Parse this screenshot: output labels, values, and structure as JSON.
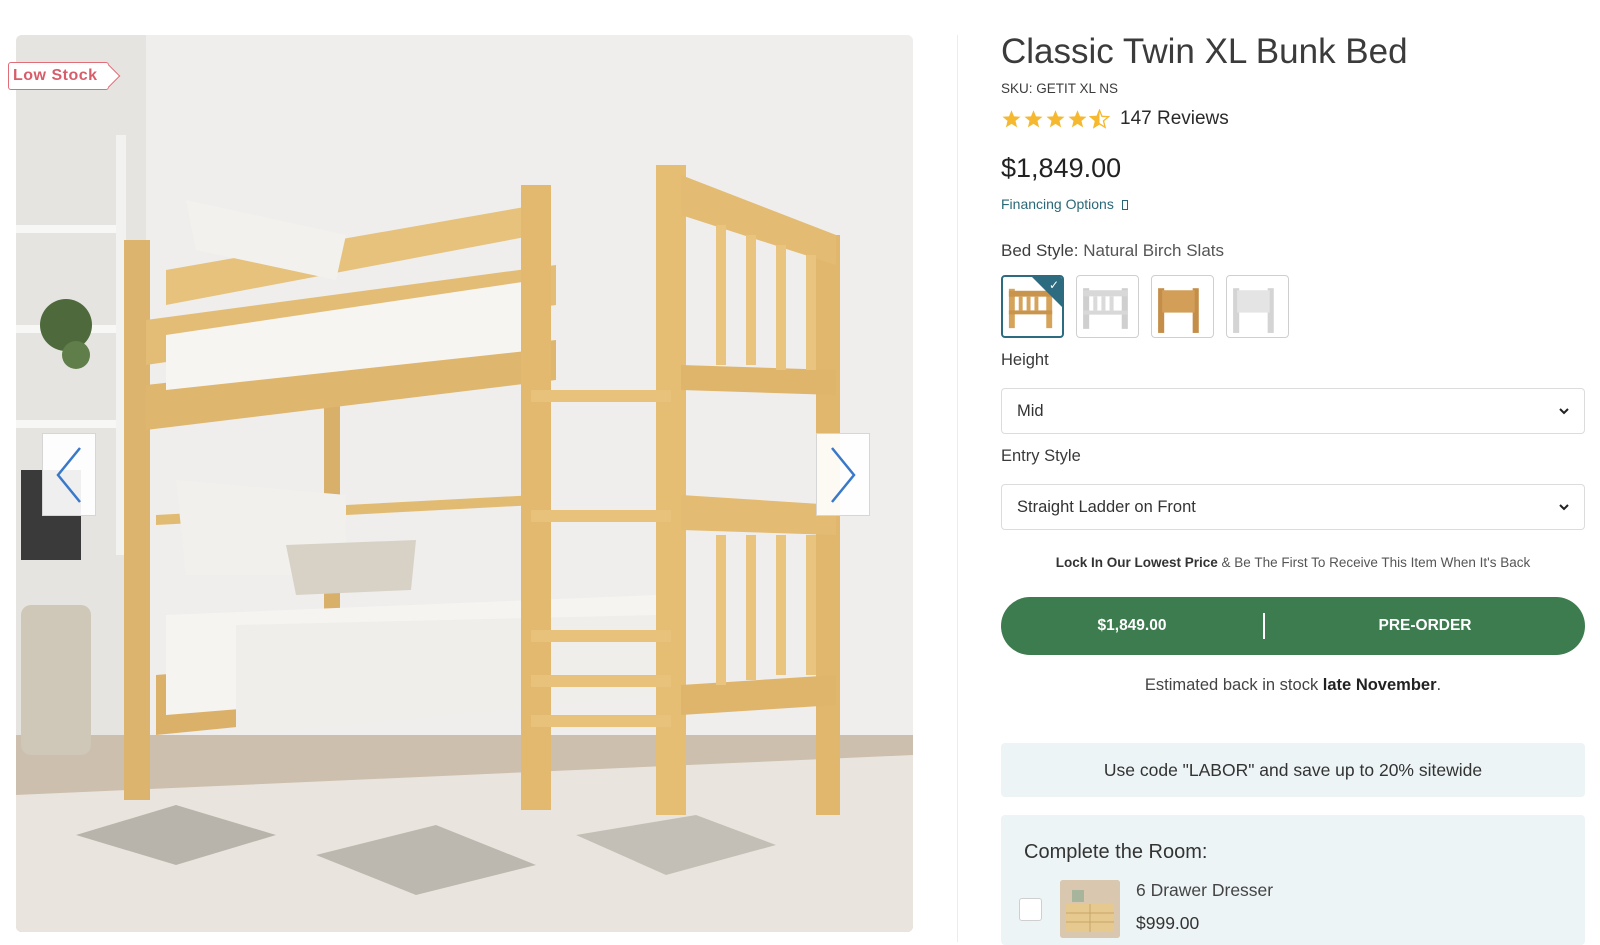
{
  "badge": {
    "low_stock": "Low Stock"
  },
  "product": {
    "title": "Classic Twin XL Bunk Bed",
    "sku": "SKU: GETIT XL NS",
    "rating": 4.5,
    "reviews_label": "147 Reviews",
    "price": "$1,849.00",
    "financing_label": "Financing Options"
  },
  "bed_style": {
    "label": "Bed Style:",
    "value": "Natural Birch Slats",
    "swatches": [
      "natural-slat-swatch",
      "white-slat-swatch",
      "natural-panel-swatch",
      "white-panel-swatch"
    ],
    "selected_index": 0
  },
  "height": {
    "label": "Height",
    "value": "Mid"
  },
  "entry_style": {
    "label": "Entry Style",
    "value": "Straight Ladder on Front"
  },
  "lock_in": {
    "bold": "Lock In Our Lowest Price",
    "rest": "& Be The First To Receive This Item When It's Back"
  },
  "cta": {
    "price": "$1,849.00",
    "action": "PRE-ORDER"
  },
  "estimate": {
    "prefix": "Estimated back in stock",
    "bold": "late November",
    "suffix": "."
  },
  "promo": "Use code \"LABOR\" and save up to 20% sitewide",
  "complete_room": {
    "title": "Complete the Room:",
    "item_name": "6 Drawer Dresser",
    "item_price": "$999.00"
  },
  "colors": {
    "accent_green": "#3d7c4f",
    "selected_teal": "#2d6c80",
    "star_gold": "#f5b82e",
    "low_stock_red": "#d85d6b"
  }
}
